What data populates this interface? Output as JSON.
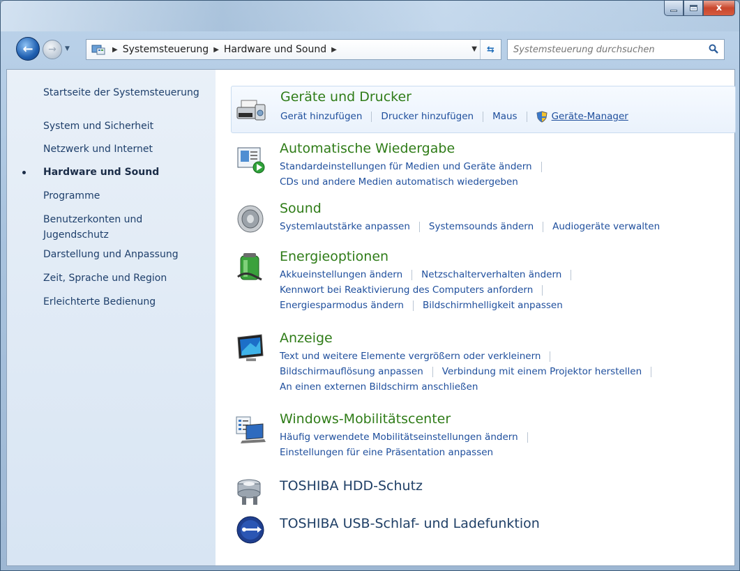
{
  "window": {
    "close_glyph": "x"
  },
  "address": {
    "crumbs": [
      "Systemsteuerung",
      "Hardware und Sound"
    ],
    "search_placeholder": "Systemsteuerung durchsuchen"
  },
  "sidebar": {
    "items": [
      {
        "label": "Startseite der Systemsteuerung"
      },
      {
        "label": "System und Sicherheit"
      },
      {
        "label": "Netzwerk und Internet"
      },
      {
        "label": "Hardware und Sound",
        "active": true
      },
      {
        "label": "Programme"
      },
      {
        "label": "Benutzerkonten und Jugendschutz"
      },
      {
        "label": "Darstellung und Anpassung"
      },
      {
        "label": "Zeit, Sprache und Region"
      },
      {
        "label": "Erleichterte Bedienung"
      }
    ]
  },
  "categories": [
    {
      "title": "Geräte und Drucker",
      "icon": "printer-icon",
      "links": [
        [
          "Gerät hinzufügen",
          "Drucker hinzufügen",
          "Maus",
          "Geräte-Manager"
        ]
      ]
    },
    {
      "title": "Automatische Wiedergabe",
      "icon": "autoplay-icon",
      "links": [
        [
          "Standardeinstellungen für Medien und Geräte ändern"
        ],
        [
          "CDs und andere Medien automatisch wiedergeben"
        ]
      ]
    },
    {
      "title": "Sound",
      "icon": "speaker-icon",
      "links": [
        [
          "Systemlautstärke anpassen",
          "Systemsounds ändern",
          "Audiogeräte verwalten"
        ]
      ]
    },
    {
      "title": "Energieoptionen",
      "icon": "battery-icon",
      "links": [
        [
          "Akkueinstellungen ändern",
          "Netzschalterverhalten ändern"
        ],
        [
          "Kennwort bei Reaktivierung des Computers anfordern"
        ],
        [
          "Energiesparmodus ändern",
          "Bildschirmhelligkeit anpassen"
        ]
      ]
    },
    {
      "title": "Anzeige",
      "icon": "display-icon",
      "links": [
        [
          "Text und weitere Elemente vergrößern oder verkleinern"
        ],
        [
          "Bildschirmauflösung anpassen",
          "Verbindung mit einem Projektor herstellen"
        ],
        [
          "An einen externen Bildschirm anschließen"
        ]
      ]
    },
    {
      "title": "Windows-Mobilitätscenter",
      "icon": "mobility-center-icon",
      "links": [
        [
          "Häufig verwendete Mobilitätseinstellungen ändern"
        ],
        [
          "Einstellungen für eine Präsentation anpassen"
        ]
      ]
    },
    {
      "title": "TOSHIBA HDD-Schutz",
      "icon": "hdd-protection-icon",
      "links": []
    },
    {
      "title": "TOSHIBA USB-Schlaf- und Ladefunktion",
      "icon": "usb-sleep-charge-icon",
      "links": []
    }
  ]
}
